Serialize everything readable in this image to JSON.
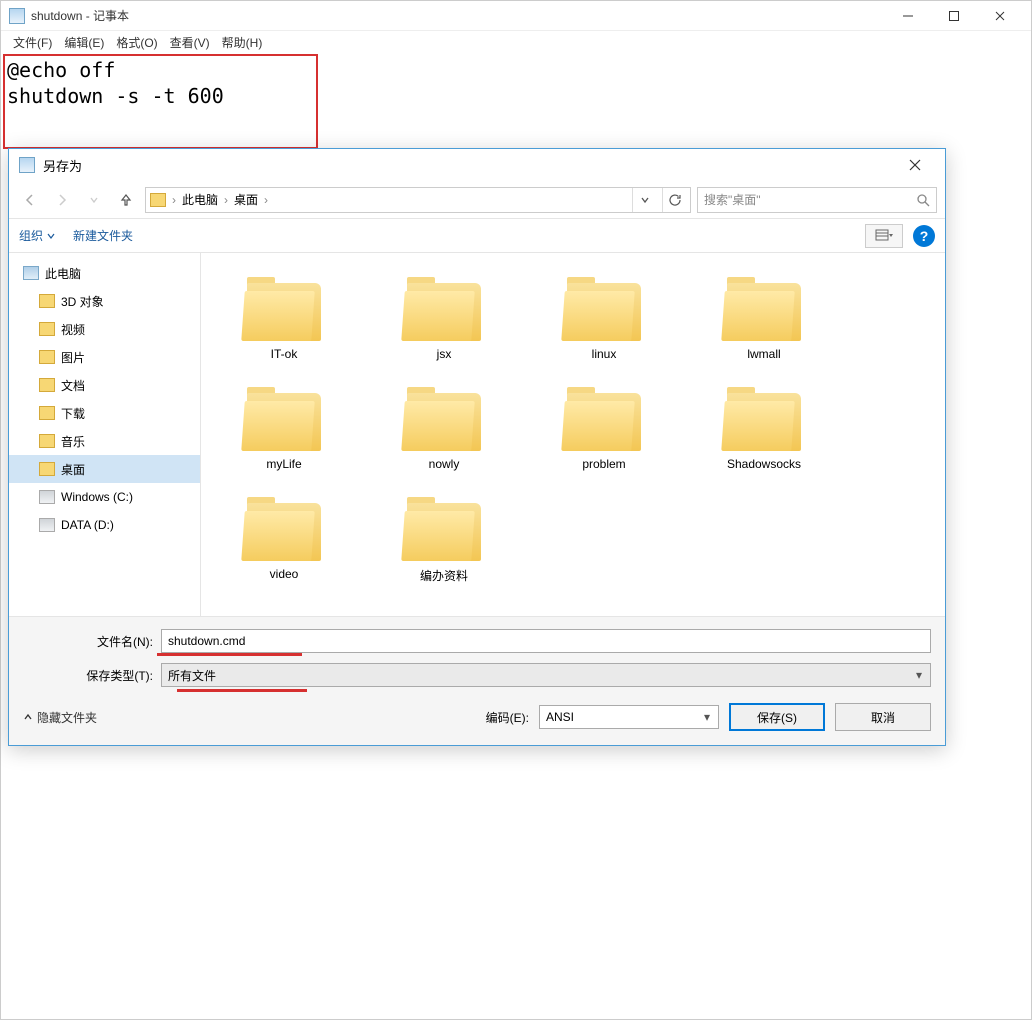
{
  "notepad": {
    "title": "shutdown - 记事本",
    "menu": {
      "file": "文件(F)",
      "edit": "编辑(E)",
      "format": "格式(O)",
      "view": "查看(V)",
      "help": "帮助(H)"
    },
    "content": "@echo off\nshutdown -s -t 600"
  },
  "dialog": {
    "title": "另存为",
    "breadcrumb": {
      "root": "此电脑",
      "location": "桌面"
    },
    "search_placeholder": "搜索\"桌面\"",
    "toolbar": {
      "organize": "组织",
      "newfolder": "新建文件夹"
    },
    "sidebar": {
      "root": "此电脑",
      "items": [
        {
          "label": "3D 对象",
          "icon": "folder"
        },
        {
          "label": "视频",
          "icon": "folder"
        },
        {
          "label": "图片",
          "icon": "folder"
        },
        {
          "label": "文档",
          "icon": "folder"
        },
        {
          "label": "下载",
          "icon": "folder"
        },
        {
          "label": "音乐",
          "icon": "folder"
        },
        {
          "label": "桌面",
          "icon": "folder",
          "selected": true
        },
        {
          "label": "Windows (C:)",
          "icon": "drive"
        },
        {
          "label": "DATA (D:)",
          "icon": "drive"
        }
      ]
    },
    "folders": [
      {
        "name": "IT-ok"
      },
      {
        "name": "jsx"
      },
      {
        "name": "linux"
      },
      {
        "name": "lwmall"
      },
      {
        "name": "myLife"
      },
      {
        "name": "nowly"
      },
      {
        "name": "problem"
      },
      {
        "name": "Shadowsocks"
      },
      {
        "name": "video"
      },
      {
        "name": "编办资料"
      }
    ],
    "filename_label": "文件名(N):",
    "filename_value": "shutdown.cmd",
    "filetype_label": "保存类型(T):",
    "filetype_value": "所有文件",
    "hide_label": "隐藏文件夹",
    "encoding_label": "编码(E):",
    "encoding_value": "ANSI",
    "save_btn": "保存(S)",
    "cancel_btn": "取消",
    "help_symbol": "?"
  }
}
